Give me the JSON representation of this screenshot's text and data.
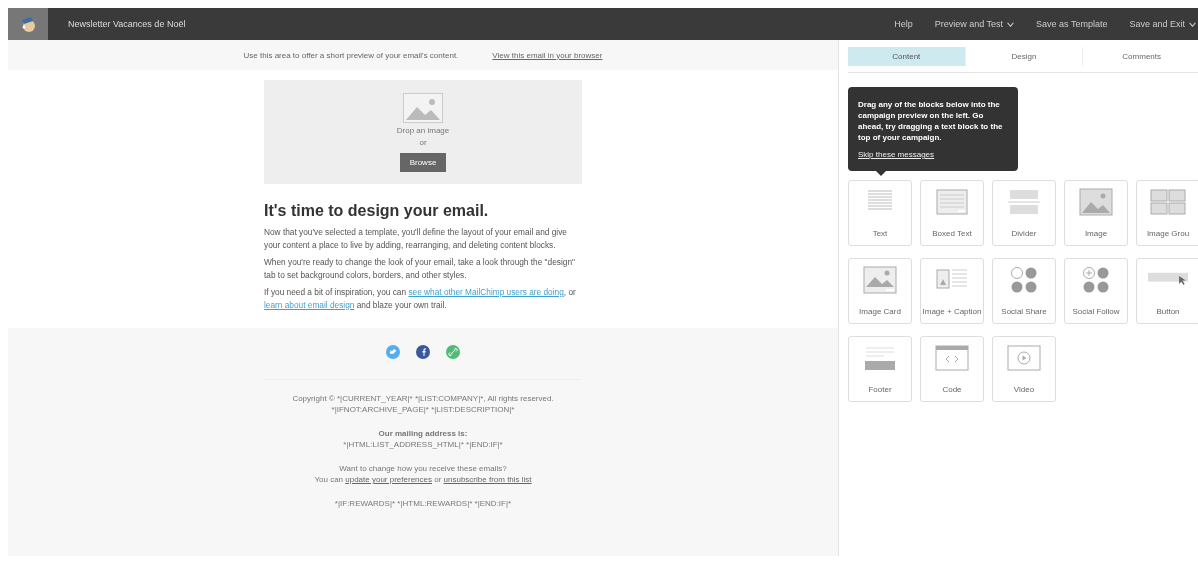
{
  "header": {
    "title": "Newsletter Vacances de Noël",
    "nav": [
      {
        "label": "Help",
        "dropdown": false
      },
      {
        "label": "Preview and Test",
        "dropdown": true
      },
      {
        "label": "Save as Template",
        "dropdown": false
      },
      {
        "label": "Save and Exit",
        "dropdown": true
      }
    ]
  },
  "email": {
    "preheader": "Use this area to offer a short preview of your email's content.",
    "view_link": "View this email in your browser",
    "image_block": {
      "prompt": "Drop an image",
      "or": "or",
      "button": "Browse"
    },
    "heading": "It's time to design your email.",
    "paragraphs": [
      [
        {
          "text": "Now that you've selected a template, you'll define the layout of your email and give your content a place to live by adding, rearranging, and deleting content blocks.",
          "link": false
        }
      ],
      [
        {
          "text": "When you're ready to change the look of your email, take a look through the \"design\" tab to set background colors, borders, and other styles.",
          "link": false
        }
      ],
      [
        {
          "text": "If you need a bit of inspiration, you can ",
          "link": false
        },
        {
          "text": "see what other MailChimp users are doing",
          "link": true
        },
        {
          "text": ", or ",
          "link": false
        },
        {
          "text": "learn about email design",
          "link": true
        },
        {
          "text": " and blaze your own trail.",
          "link": false
        }
      ]
    ],
    "social": [
      {
        "kind": "twitter",
        "color": "#55acee"
      },
      {
        "kind": "facebook",
        "color": "#3b5998"
      },
      {
        "kind": "link",
        "color": "#4dbd74"
      }
    ],
    "footer": [
      {
        "kind": "plain",
        "lines": [
          [
            {
              "text": "Copyright © *|CURRENT_YEAR|* *|LIST:COMPANY|*, All rights reserved.",
              "link": false
            }
          ],
          [
            {
              "text": "*|IFNOT:ARCHIVE_PAGE|* *|LIST:DESCRIPTION|*",
              "link": false
            }
          ]
        ]
      },
      {
        "kind": "bold",
        "lines": [
          [
            {
              "text": "Our mailing address is:",
              "link": false
            }
          ],
          [
            {
              "text": "*|HTML:LIST_ADDRESS_HTML|* *|END:IF|*",
              "link": false
            }
          ]
        ]
      },
      {
        "kind": "plain",
        "lines": [
          [
            {
              "text": "Want to change how you receive these emails?",
              "link": false
            }
          ],
          [
            {
              "text": "You can ",
              "link": false
            },
            {
              "text": "update your preferences",
              "link": true
            },
            {
              "text": " or ",
              "link": false
            },
            {
              "text": "unsubscribe from this list",
              "link": true
            }
          ]
        ]
      },
      {
        "kind": "plain",
        "lines": [
          [
            {
              "text": "*|IF:REWARDS|* *|HTML:REWARDS|* *|END:IF|*",
              "link": false
            }
          ]
        ]
      }
    ]
  },
  "panel": {
    "tabs": [
      {
        "label": "Content",
        "selected": true
      },
      {
        "label": "Design",
        "selected": false
      },
      {
        "label": "Comments",
        "selected": false
      }
    ],
    "tooltip": {
      "text": "Drag any of the blocks below into the campaign preview on the left. Go ahead, try dragging a text block to the top of your campaign.",
      "link": "Skip these messages"
    },
    "blocks": [
      {
        "kind": "text",
        "label": "Text"
      },
      {
        "kind": "boxed",
        "label": "Boxed Text"
      },
      {
        "kind": "divider",
        "label": "Divider"
      },
      {
        "kind": "image",
        "label": "Image"
      },
      {
        "kind": "group",
        "label": "Image Grou"
      },
      {
        "kind": "card",
        "label": "Image Card"
      },
      {
        "kind": "caption",
        "label": "Image + Caption"
      },
      {
        "kind": "share",
        "label": "Social Share"
      },
      {
        "kind": "follow",
        "label": "Social Follow"
      },
      {
        "kind": "button",
        "label": "Button"
      },
      {
        "kind": "footer",
        "label": "Footer"
      },
      {
        "kind": "code",
        "label": "Code"
      },
      {
        "kind": "video",
        "label": "Video"
      }
    ]
  }
}
